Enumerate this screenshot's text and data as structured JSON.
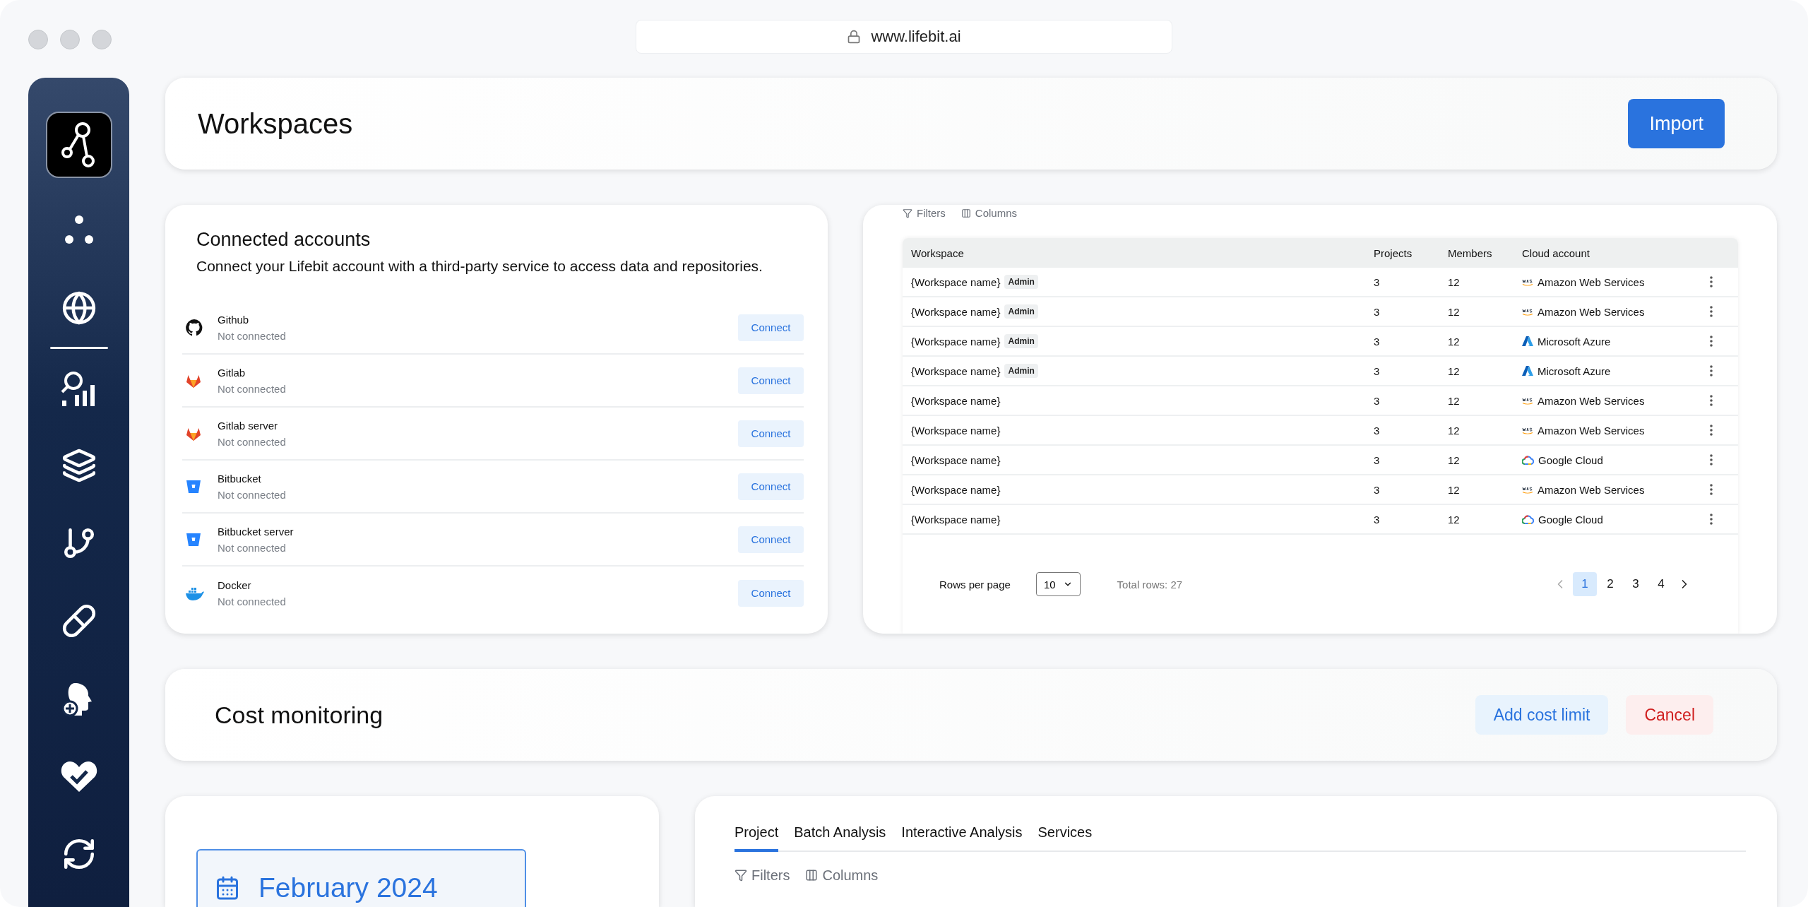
{
  "browser": {
    "url": "www.lifebit.ai"
  },
  "header": {
    "title": "Workspaces",
    "button": "Import"
  },
  "connected_accounts": {
    "title": "Connected accounts",
    "description": "Connect your Lifebit account with a third-party service to access data and repositories.",
    "accounts": [
      {
        "kind": "github",
        "name": "Github",
        "status": "Not connected",
        "button": "Connect"
      },
      {
        "kind": "gitlab",
        "name": "Gitlab",
        "status": "Not connected",
        "button": "Connect"
      },
      {
        "kind": "gitlab",
        "name": "Gitlab server",
        "status": "Not connected",
        "button": "Connect"
      },
      {
        "kind": "bitbucket",
        "name": "Bitbucket",
        "status": "Not connected",
        "button": "Connect"
      },
      {
        "kind": "bitbucket",
        "name": "Bitbucket server",
        "status": "Not connected",
        "button": "Connect"
      },
      {
        "kind": "docker",
        "name": "Docker",
        "status": "Not connected",
        "button": "Connect"
      }
    ]
  },
  "workspaces_table": {
    "toolbar": [
      "Filters",
      "Columns"
    ],
    "columns": [
      "Workspace",
      "Projects",
      "Members",
      "Cloud account"
    ],
    "rows": [
      {
        "workspace": "{Workspace name}",
        "badge": "Admin",
        "projects": "3",
        "members": "12",
        "cloud": {
          "kind": "aws",
          "name": "Amazon Web Services"
        }
      },
      {
        "workspace": "{Workspace name}",
        "badge": "Admin",
        "projects": "3",
        "members": "12",
        "cloud": {
          "kind": "aws",
          "name": "Amazon Web Services"
        }
      },
      {
        "workspace": "{Workspace name}",
        "badge": "Admin",
        "projects": "3",
        "members": "12",
        "cloud": {
          "kind": "azure",
          "name": "Microsoft Azure"
        }
      },
      {
        "workspace": "{Workspace name}",
        "badge": "Admin",
        "projects": "3",
        "members": "12",
        "cloud": {
          "kind": "azure",
          "name": "Microsoft Azure"
        }
      },
      {
        "workspace": "{Workspace name}",
        "projects": "3",
        "members": "12",
        "cloud": {
          "kind": "aws",
          "name": "Amazon Web Services"
        }
      },
      {
        "workspace": "{Workspace name}",
        "projects": "3",
        "members": "12",
        "cloud": {
          "kind": "aws",
          "name": "Amazon Web Services"
        }
      },
      {
        "workspace": "{Workspace name}",
        "projects": "3",
        "members": "12",
        "cloud": {
          "kind": "gcp",
          "name": "Google Cloud"
        }
      },
      {
        "workspace": "{Workspace name}",
        "projects": "3",
        "members": "12",
        "cloud": {
          "kind": "aws",
          "name": "Amazon Web Services"
        }
      },
      {
        "workspace": "{Workspace name}",
        "projects": "3",
        "members": "12",
        "cloud": {
          "kind": "gcp",
          "name": "Google Cloud"
        }
      }
    ],
    "pagination": {
      "rows_per_page_label": "Rows per page",
      "rows_per_page": "10",
      "total": "Total rows: 27",
      "pages": [
        {
          "label": "1",
          "selected": true
        },
        {
          "label": "2",
          "selected": false
        },
        {
          "label": "3",
          "selected": false
        },
        {
          "label": "4",
          "selected": false
        }
      ]
    }
  },
  "cost_monitoring": {
    "title": "Cost monitoring",
    "buttons": [
      {
        "label": "Add cost limit",
        "kind": "primary"
      },
      {
        "label": "Cancel",
        "kind": "danger"
      }
    ]
  },
  "date_picker": {
    "value": "February 2024"
  },
  "usage": {
    "tabs": [
      {
        "label": "Project",
        "selected": true
      },
      {
        "label": "Batch Analysis",
        "selected": false
      },
      {
        "label": "Interactive Analysis",
        "selected": false
      },
      {
        "label": "Services",
        "selected": false
      }
    ],
    "toolbar": [
      "Filters",
      "Columns"
    ]
  }
}
